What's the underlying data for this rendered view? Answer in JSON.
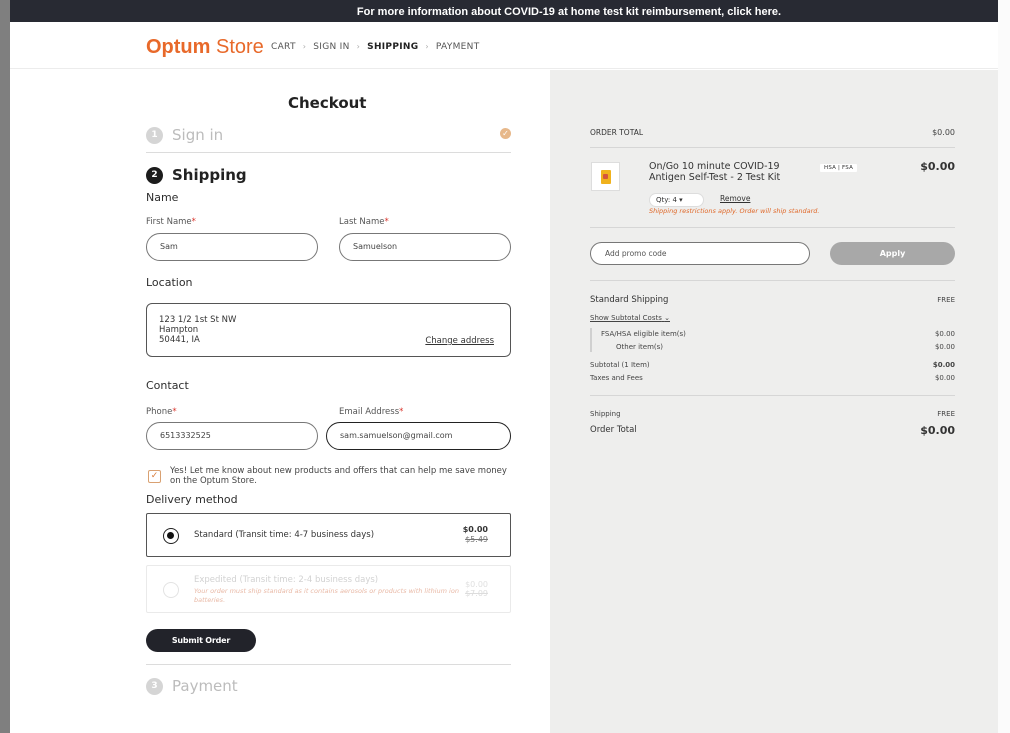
{
  "banner": {
    "text": "For more information about COVID-19 at home test kit reimbursement, click here."
  },
  "header": {
    "logo_bold": "Optum",
    "logo_light": " Store",
    "breadcrumbs": [
      "CART",
      "SIGN IN",
      "SHIPPING",
      "PAYMENT"
    ]
  },
  "checkout": {
    "title": "Checkout",
    "steps": [
      {
        "num": "1",
        "label": "Sign in"
      },
      {
        "num": "2",
        "label": "Shipping"
      },
      {
        "num": "3",
        "label": "Payment"
      }
    ],
    "name_section": "Name",
    "first_name_label": "First Name",
    "first_name_value": "Sam",
    "last_name_label": "Last Name",
    "last_name_value": "Samuelson",
    "required_mark": "*",
    "location_section": "Location",
    "address": {
      "line1": "123 1/2 1st St NW",
      "line2": "Hampton",
      "line3": "50441, IA",
      "change_link": "Change address"
    },
    "contact_section": "Contact",
    "phone_label": "Phone",
    "phone_value": "6513332525",
    "email_label": "Email Address",
    "email_value": "sam.samuelson@gmail.com",
    "optin_text": "Yes! Let me know about new products and offers that can help me save money on the Optum Store.",
    "delivery_section": "Delivery method",
    "delivery": [
      {
        "label": "Standard (Transit time: 4-7 business days)",
        "price": "$0.00",
        "old_price": "$5.49"
      },
      {
        "label": "Expedited (Transit time: 2-4 business days)",
        "price": "$0.00",
        "old_price": "$7.09",
        "note": "Your order must ship standard as it contains aerosols or products with lithium ion batteries."
      }
    ],
    "submit_label": "Submit Order"
  },
  "summary": {
    "order_total_label": "ORDER TOTAL",
    "order_total_value": "$0.00",
    "product": {
      "name": "On/Go 10 minute COVID-19 Antigen Self-Test - 2 Test Kit",
      "badge": "HSA | FSA",
      "price": "$0.00",
      "qty": "Qty: 4",
      "remove": "Remove",
      "restriction": "Shipping restrictions apply. Order will ship standard."
    },
    "promo_placeholder": "Add promo code",
    "apply_label": "Apply",
    "standard_shipping_label": "Standard Shipping",
    "standard_shipping_value": "FREE",
    "show_subtotal": "Show Subtotal Costs",
    "fsa_label": "FSA/HSA eligible item(s)",
    "fsa_value": "$0.00",
    "other_label": "Other item(s)",
    "other_value": "$0.00",
    "subtotal_label": "Subtotal (1 Item)",
    "subtotal_value": "$0.00",
    "taxes_label": "Taxes and Fees",
    "taxes_value": "$0.00",
    "shipping_label": "Shipping",
    "shipping_value": "FREE",
    "total_label": "Order Total",
    "total_value": "$0.00"
  },
  "colors": {
    "brand": "#e8692a",
    "dark": "#22232a",
    "sidebar_bg": "#eeeeed",
    "banner_bg": "#282a33"
  }
}
